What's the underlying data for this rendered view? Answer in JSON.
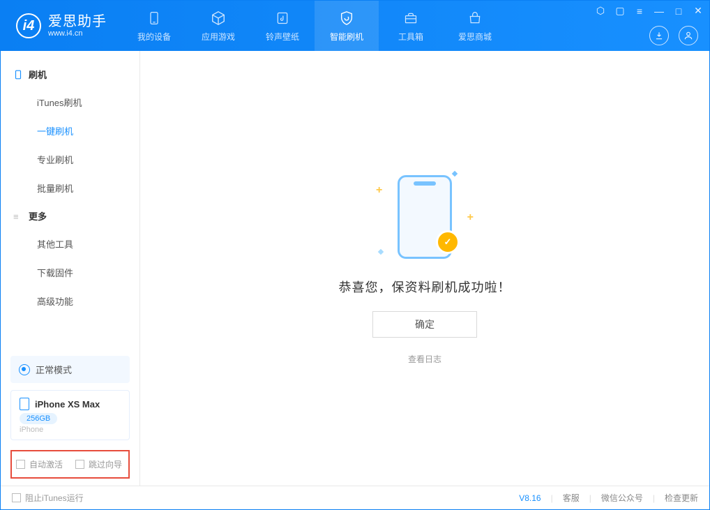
{
  "brand": {
    "name": "爱思助手",
    "url": "www.i4.cn"
  },
  "tabs": [
    {
      "label": "我的设备",
      "icon": "device"
    },
    {
      "label": "应用游戏",
      "icon": "cube"
    },
    {
      "label": "铃声壁纸",
      "icon": "music"
    },
    {
      "label": "智能刷机",
      "icon": "shield"
    },
    {
      "label": "工具箱",
      "icon": "toolbox"
    },
    {
      "label": "爱思商城",
      "icon": "store"
    }
  ],
  "active_tab_index": 3,
  "sidebar": {
    "section1": {
      "title": "刷机",
      "items": [
        "iTunes刷机",
        "一键刷机",
        "专业刷机",
        "批量刷机"
      ],
      "active_index": 1
    },
    "section2": {
      "title": "更多",
      "items": [
        "其他工具",
        "下载固件",
        "高级功能"
      ]
    }
  },
  "mode": {
    "label": "正常模式"
  },
  "device": {
    "name": "iPhone XS Max",
    "storage": "256GB",
    "type": "iPhone"
  },
  "bottom_checks": {
    "auto_activate": "自动激活",
    "skip_guide": "跳过向导"
  },
  "main": {
    "message": "恭喜您，保资料刷机成功啦！",
    "ok_label": "确定",
    "log_label": "查看日志"
  },
  "statusbar": {
    "block_itunes": "阻止iTunes运行",
    "version": "V8.16",
    "links": [
      "客服",
      "微信公众号",
      "检查更新"
    ]
  }
}
